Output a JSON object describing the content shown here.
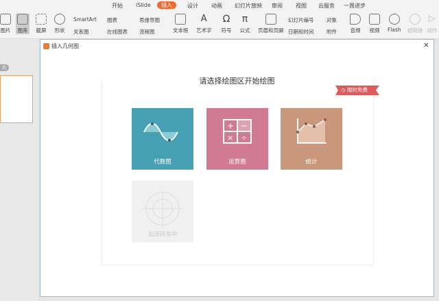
{
  "tabs": [
    "开始",
    "iSlide",
    "插入",
    "设计",
    "动画",
    "幻灯片放映",
    "审阅",
    "视图",
    "云服务",
    "一周进步"
  ],
  "active_tab": "插入",
  "ribbon": {
    "picture": "图片",
    "gallery": "图库",
    "screenshot": "截屏",
    "shape": "形状",
    "smartart": "SmartArt",
    "relation": "关系图",
    "chart": "图表",
    "online_chart": "在线图表",
    "mindmap": "思维导图",
    "flowchart": "流程图",
    "textbox": "文本框",
    "wordart": "艺术字",
    "symbol": "符号",
    "formula": "公式",
    "header_footer": "页眉和页脚",
    "slide_number": "幻灯片编号",
    "object": "对象",
    "datetime": "日期和时间",
    "attachment": "附件",
    "audio": "音频",
    "video": "视频",
    "flash": "Flash",
    "hyperlink": "超链接",
    "action": "动作"
  },
  "left": {
    "label": "片"
  },
  "dialog": {
    "title": "插入几何图",
    "close": "×",
    "heading": "请选择绘图区开始绘图",
    "badge": "限时免费",
    "cards": [
      {
        "label": "代数图",
        "color": "#45a0b4"
      },
      {
        "label": "运算图",
        "color": "#d07a93"
      },
      {
        "label": "统计",
        "color": "#c8977c"
      },
      {
        "label": "加速研发中",
        "color": "#f0f0f0"
      }
    ]
  }
}
